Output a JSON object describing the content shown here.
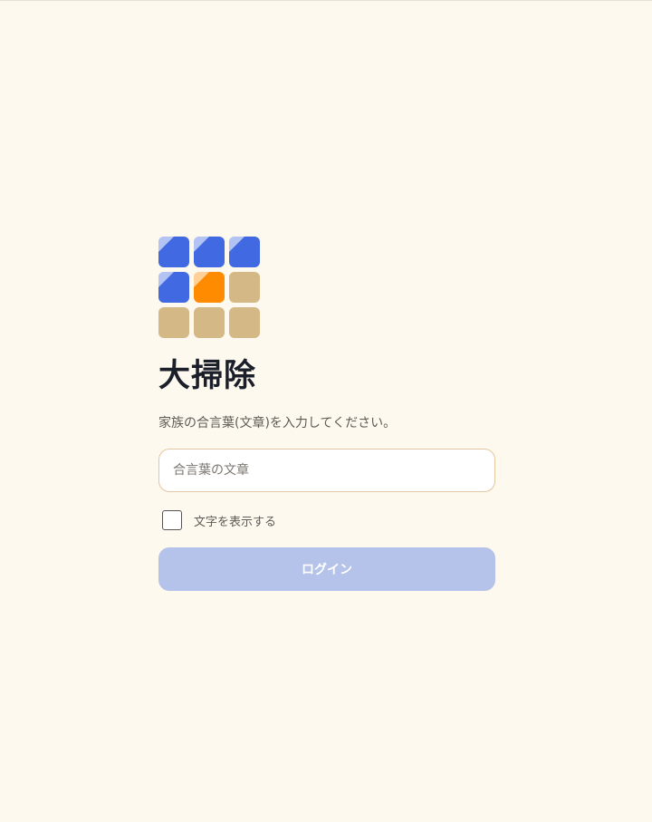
{
  "app": {
    "title": "大掃除",
    "description": "家族の合言葉(文章)を入力してください。"
  },
  "logo": {
    "tiles": [
      {
        "color": "#4169e1",
        "shine": true
      },
      {
        "color": "#4169e1",
        "shine": true
      },
      {
        "color": "#4169e1",
        "shine": true
      },
      {
        "color": "#4169e1",
        "shine": true
      },
      {
        "color": "#ff8c00",
        "shine": true
      },
      {
        "color": "#d4b886",
        "shine": false
      },
      {
        "color": "#d4b886",
        "shine": false
      },
      {
        "color": "#d4b886",
        "shine": false
      },
      {
        "color": "#d4b886",
        "shine": false
      }
    ]
  },
  "form": {
    "password_placeholder": "合言葉の文章",
    "password_value": "",
    "show_text_label": "文字を表示する",
    "show_text_checked": false,
    "login_label": "ログイン"
  },
  "colors": {
    "background": "#fdf9ef",
    "primary_disabled": "#b5c2ea",
    "input_border": "#e3c6a3"
  }
}
